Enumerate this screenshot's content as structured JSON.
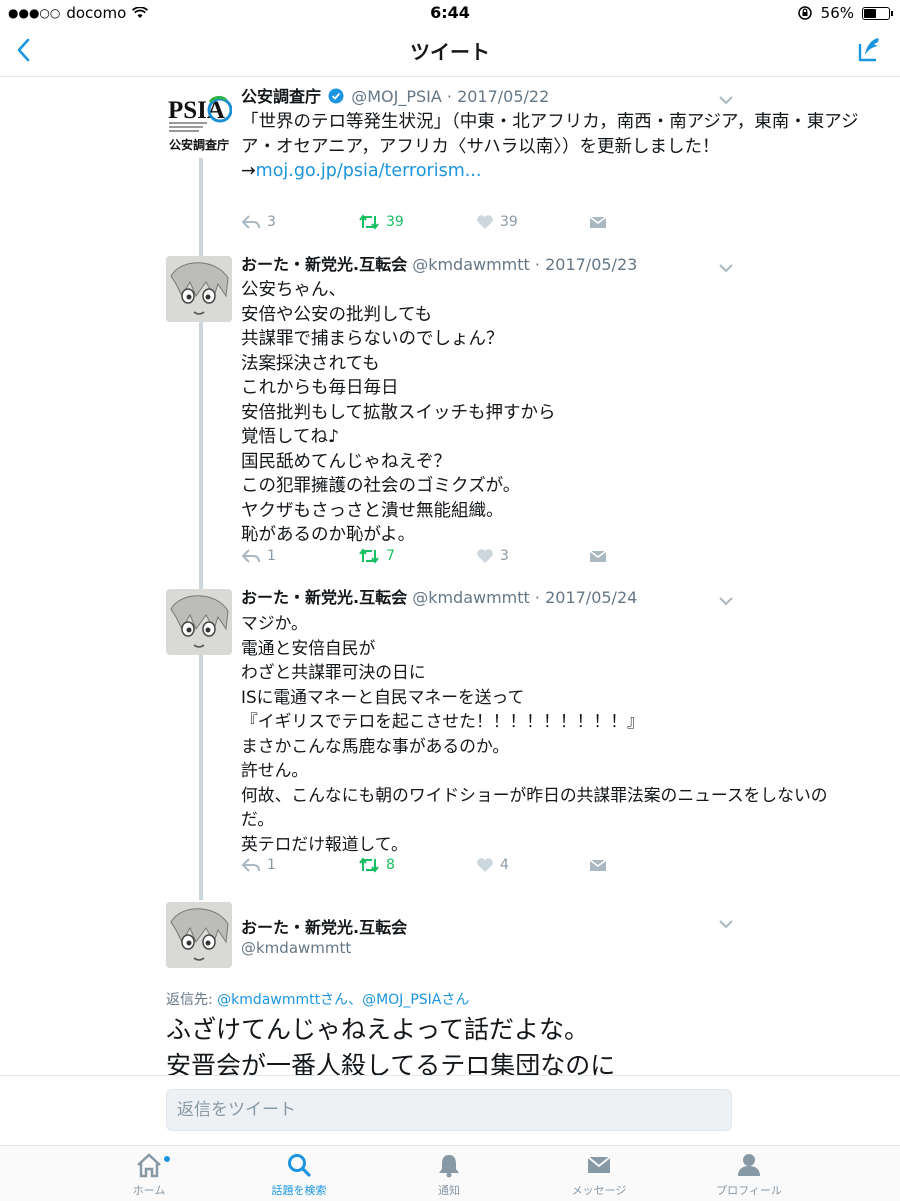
{
  "status": {
    "carrier": "docomo",
    "time": "6:44",
    "battery": "56%",
    "battery_level": 0.56
  },
  "nav": {
    "title": "ツイート"
  },
  "tweets": [
    {
      "name": "公安調査庁",
      "verified": true,
      "handle": "@MOJ_PSIA",
      "date": "· 2017/05/22",
      "avatar_brand": "PSIA",
      "avatar_caption": "公安調査庁",
      "text": "「世界のテロ等発生状況」（中東・北アフリカ，南西・南アジア，東南・東アジア・オセアニア，アフリカ〈サハラ以南〉）を更新しました！",
      "link_prefix": "→",
      "link": "moj.go.jp/psia/terrorism...",
      "replies": "3",
      "retweets": "39",
      "likes": "39"
    },
    {
      "name": "おーた・新党光.互転会",
      "handle": "@kmdawmmtt",
      "date": "· 2017/05/23",
      "text": "公安ちゃん、\n安倍や公安の批判しても\n共謀罪で捕まらないのでしょん？\n法案採決されても\nこれからも毎日毎日\n安倍批判もして拡散スイッチも押すから\n覚悟してね♪\n国民舐めてんじゃねえぞ？\nこの犯罪擁護の社会のゴミクズが。\nヤクザもさっさと潰せ無能組織。\n恥があるのか恥がよ。",
      "replies": "1",
      "retweets": "7",
      "likes": "3"
    },
    {
      "name": "おーた・新党光.互転会",
      "handle": "@kmdawmmtt",
      "date": "· 2017/05/24",
      "text": "マジか。\n電通と安倍自民が\nわざと共謀罪可決の日に\nISに電通マネーと自民マネーを送って\n『イギリスでテロを起こさせた！！！！！！！！！』\nまさかこんな馬鹿な事があるのか。\n許せん。\n何故、こんなにも朝のワイドショーが昨日の共謀罪法案のニュースをしないのだ。\n英テロだけ報道して。",
      "replies": "1",
      "retweets": "8",
      "likes": "4"
    }
  ],
  "focused_tweet": {
    "name": "おーた・新党光.互転会",
    "handle": "@kmdawmmtt",
    "reply_to_label": "返信先: ",
    "reply_to_mentions": "@kmdawmmttさん、@MOJ_PSIAさん",
    "text": "ふざけてんじゃねえよって話だよな。\n安晋会が一番人殺してるテロ集団なのに"
  },
  "composer": {
    "placeholder": "返信をツイート"
  },
  "tabs": [
    {
      "label": "ホーム",
      "icon": "home-icon"
    },
    {
      "label": "話題を検索",
      "icon": "search-icon",
      "active": true
    },
    {
      "label": "通知",
      "icon": "bell-icon"
    },
    {
      "label": "メッセージ",
      "icon": "envelope-icon"
    },
    {
      "label": "プロフィール",
      "icon": "person-icon"
    }
  ],
  "colors": {
    "link": "#1b95e0",
    "retweet": "#17bf63",
    "muted": "#8899a6",
    "border": "#e1e8ed"
  }
}
